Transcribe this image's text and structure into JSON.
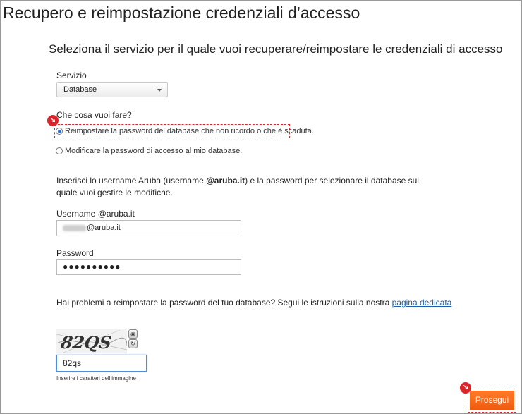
{
  "title": "Recupero e reimpostazione credenziali d’accesso",
  "subtitle": "Seleziona il servizio per il quale vuoi recuperare/reimpostare le credenziali di accesso",
  "service": {
    "label": "Servizio",
    "selected": "Database"
  },
  "action": {
    "question": "Che cosa vuoi fare?",
    "options": [
      {
        "label": "Reimpostare la password del database che non ricordo o che è scaduta.",
        "checked": true
      },
      {
        "label": "Modificare la password di accesso al mio database.",
        "checked": false
      }
    ]
  },
  "instructions": {
    "before": "Inserisci lo username Aruba (username ",
    "bold": "@aruba.it",
    "after": ") e la password per selezionare il database sul quale vuoi gestire le modifiche."
  },
  "username": {
    "label": "Username @aruba.it",
    "suffix": "@aruba.it"
  },
  "password": {
    "label": "Password",
    "value": "●●●●●●●●●●"
  },
  "help": {
    "text": "Hai problemi a reimpostare la password del tuo database? Segui le istruzioni sulla nostra ",
    "link": "pagina dedicata"
  },
  "captcha": {
    "image_text": "82QS",
    "value": "82qs",
    "hint": "Inserire i caratteri dell’immagine"
  },
  "submit_label": "Prosegui",
  "colors": {
    "accent": "#f26419",
    "highlight": "#d9262c",
    "link": "#1f5fa8"
  }
}
